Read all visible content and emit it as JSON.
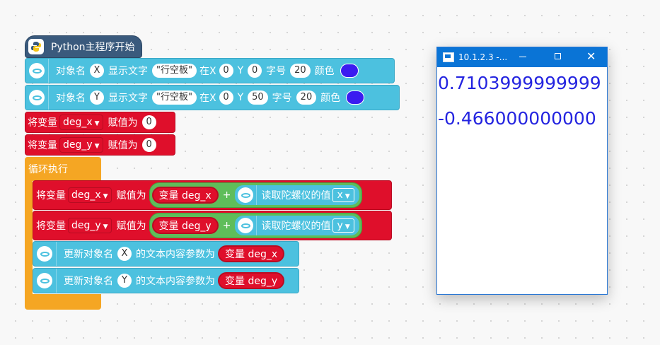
{
  "program": {
    "hat_label": "Python主程序开始",
    "text_blocks": [
      {
        "pre": "对象名",
        "name": "X",
        "show_text": "显示文字",
        "text_value": "\"行空板\"",
        "x_label": "在X",
        "x": "0",
        "y_label": "Y",
        "y": "0",
        "size_label": "字号",
        "size": "20",
        "color_label": "颜色"
      },
      {
        "pre": "对象名",
        "name": "Y",
        "show_text": "显示文字",
        "text_value": "\"行空板\"",
        "x_label": "在X",
        "x": "0",
        "y_label": "Y",
        "y": "50",
        "size_label": "字号",
        "size": "20",
        "color_label": "颜色"
      }
    ],
    "set_blocks": [
      {
        "pre": "将变量",
        "var": "deg_x",
        "mid": "赋值为",
        "value": "0"
      },
      {
        "pre": "将变量",
        "var": "deg_y",
        "mid": "赋值为",
        "value": "0"
      }
    ],
    "loop_label": "循环执行",
    "loop_sets": [
      {
        "pre": "将变量",
        "var": "deg_x",
        "mid": "赋值为",
        "var_ref": "变量 deg_x",
        "plus": "+",
        "read_label": "读取陀螺仪的值",
        "axis": "x"
      },
      {
        "pre": "将变量",
        "var": "deg_y",
        "mid": "赋值为",
        "var_ref": "变量 deg_y",
        "plus": "+",
        "read_label": "读取陀螺仪的值",
        "axis": "y"
      }
    ],
    "update_blocks": [
      {
        "pre": "更新对象名",
        "name": "X",
        "mid": "的文本内容参数为",
        "var_ref": "变量 deg_x"
      },
      {
        "pre": "更新对象名",
        "name": "Y",
        "mid": "的文本内容参数为",
        "var_ref": "变量 deg_y"
      }
    ],
    "color_value": "#3a1cf0"
  },
  "window": {
    "title": "10.1.2.3 -...",
    "line1": "0.7103999999999",
    "line2": "-0.466000000000"
  }
}
